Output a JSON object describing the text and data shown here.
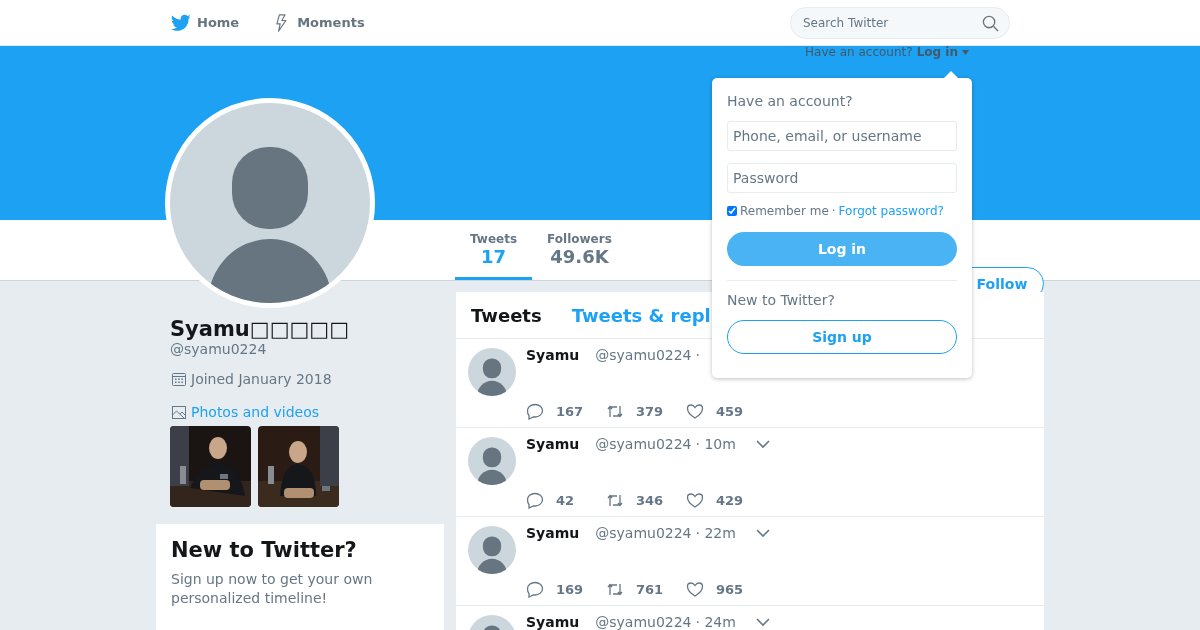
{
  "nav": {
    "items": [
      {
        "label": "Home"
      },
      {
        "label": "Moments"
      }
    ],
    "search": {
      "placeholder": "Search Twitter"
    }
  },
  "account_prompt": {
    "text": "Have an account?",
    "link": "Log in"
  },
  "profile": {
    "name": "Syamu□□□□□",
    "handle": "@syamu0224",
    "joined": "Joined January 2018",
    "media_link": "Photos and videos"
  },
  "stats": [
    {
      "label": "Tweets",
      "value": "17",
      "selected": true
    },
    {
      "label": "Followers",
      "value": "49.6K",
      "selected": false
    }
  ],
  "follow_button": "Follow",
  "timeline_tabs": [
    {
      "label": "Tweets",
      "selected": true
    },
    {
      "label": "Tweets & repl",
      "selected": false
    }
  ],
  "tweets": [
    {
      "name": "Syamu",
      "handle": "@syamu0224",
      "time": "·",
      "chevron": false,
      "replies": "167",
      "retweets": "379",
      "likes": "459"
    },
    {
      "name": "Syamu",
      "handle": "@syamu0224",
      "time": "· 10m",
      "chevron": true,
      "replies": "42",
      "retweets": "346",
      "likes": "429"
    },
    {
      "name": "Syamu",
      "handle": "@syamu0224",
      "time": "· 22m",
      "chevron": true,
      "replies": "169",
      "retweets": "761",
      "likes": "965"
    },
    {
      "name": "Syamu",
      "handle": "@syamu0224",
      "time": "· 24m",
      "chevron": true
    }
  ],
  "signup_card": {
    "title": "New to Twitter?",
    "text": "Sign up now to get your own personalized timeline!"
  },
  "login_dropdown": {
    "title": "Have an account?",
    "username_placeholder": "Phone, email, or username",
    "password_placeholder": "Password",
    "remember": {
      "label": "Remember me",
      "checked": true
    },
    "separator": "·",
    "forgot": "Forgot password?",
    "login_button": "Log in",
    "new_title": "New to Twitter?",
    "signup_button": "Sign up"
  }
}
